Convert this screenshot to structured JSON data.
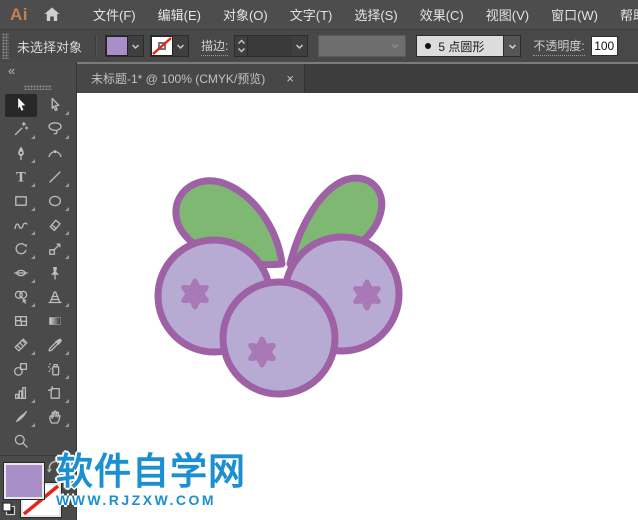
{
  "menubar": {
    "logo": "Ai",
    "items": [
      {
        "key": "file",
        "label": "文件(F)"
      },
      {
        "key": "edit",
        "label": "编辑(E)"
      },
      {
        "key": "object",
        "label": "对象(O)"
      },
      {
        "key": "type",
        "label": "文字(T)"
      },
      {
        "key": "select",
        "label": "选择(S)"
      },
      {
        "key": "effect",
        "label": "效果(C)"
      },
      {
        "key": "view",
        "label": "视图(V)"
      },
      {
        "key": "window",
        "label": "窗口(W)"
      },
      {
        "key": "help",
        "label": "帮助(H)"
      }
    ]
  },
  "options_bar": {
    "status": "未选择对象",
    "fill_color": "#a98fc7",
    "stroke_label": "描边:",
    "brush_style": "5 点圆形",
    "opacity_label": "不透明度:",
    "opacity_value": "100"
  },
  "document_tab": {
    "title": "未标题-1* @ 100% (CMYK/预览)",
    "close": "×"
  },
  "tool_panel": {
    "collapse": "«",
    "tools": [
      {
        "name": "selection-tool",
        "icon": "selection",
        "active": true,
        "flyout": false
      },
      {
        "name": "direct-selection-tool",
        "icon": "direct",
        "active": false,
        "flyout": true
      },
      {
        "name": "magic-wand-tool",
        "icon": "wand",
        "active": false,
        "flyout": true
      },
      {
        "name": "lasso-tool",
        "icon": "lasso",
        "active": false,
        "flyout": true
      },
      {
        "name": "pen-tool",
        "icon": "pen",
        "active": false,
        "flyout": true
      },
      {
        "name": "curvature-tool",
        "icon": "curvature",
        "active": false,
        "flyout": false
      },
      {
        "name": "type-tool",
        "icon": "type",
        "active": false,
        "flyout": true
      },
      {
        "name": "line-segment-tool",
        "icon": "line",
        "active": false,
        "flyout": true
      },
      {
        "name": "rectangle-tool",
        "icon": "rectangle",
        "active": false,
        "flyout": true
      },
      {
        "name": "ellipse-tool",
        "icon": "ellipse",
        "active": false,
        "flyout": true
      },
      {
        "name": "shaper-tool",
        "icon": "shaper",
        "active": false,
        "flyout": true
      },
      {
        "name": "eraser-tool",
        "icon": "eraser",
        "active": false,
        "flyout": true
      },
      {
        "name": "rotate-tool",
        "icon": "rotate",
        "active": false,
        "flyout": true
      },
      {
        "name": "scale-tool",
        "icon": "scale",
        "active": false,
        "flyout": true
      },
      {
        "name": "width-tool",
        "icon": "width",
        "active": false,
        "flyout": true
      },
      {
        "name": "puppet-warp-tool",
        "icon": "puppet",
        "active": false,
        "flyout": false
      },
      {
        "name": "shape-builder-tool",
        "icon": "shapebuilder",
        "active": false,
        "flyout": true
      },
      {
        "name": "perspective-grid-tool",
        "icon": "perspective",
        "active": false,
        "flyout": true
      },
      {
        "name": "mesh-tool",
        "icon": "mesh",
        "active": false,
        "flyout": false
      },
      {
        "name": "gradient-tool",
        "icon": "gradient",
        "active": false,
        "flyout": false
      },
      {
        "name": "measure-tool",
        "icon": "measure",
        "active": false,
        "flyout": true
      },
      {
        "name": "eyedropper-tool",
        "icon": "eyedropper",
        "active": false,
        "flyout": true
      },
      {
        "name": "blend-tool",
        "icon": "blend",
        "active": false,
        "flyout": false
      },
      {
        "name": "symbol-sprayer-tool",
        "icon": "sprayer",
        "active": false,
        "flyout": true
      },
      {
        "name": "column-graph-tool",
        "icon": "graph",
        "active": false,
        "flyout": true
      },
      {
        "name": "artboard-tool",
        "icon": "artboard",
        "active": false,
        "flyout": true
      },
      {
        "name": "slice-tool",
        "icon": "slice",
        "active": false,
        "flyout": true
      },
      {
        "name": "hand-tool",
        "icon": "hand",
        "active": false,
        "flyout": true
      },
      {
        "name": "zoom-tool",
        "icon": "zoomtool",
        "active": false,
        "flyout": false
      }
    ]
  },
  "artwork": {
    "subject": "blueberries-with-leaves",
    "colors": {
      "berry_fill": "#b7abd3",
      "berry_stroke": "#9e61a5",
      "star": "#a978b6",
      "leaf": "#7eb873"
    }
  },
  "watermark": {
    "title": "软件自学网",
    "url": "WWW.RJZXW.COM",
    "color": "#1b8fd0"
  }
}
